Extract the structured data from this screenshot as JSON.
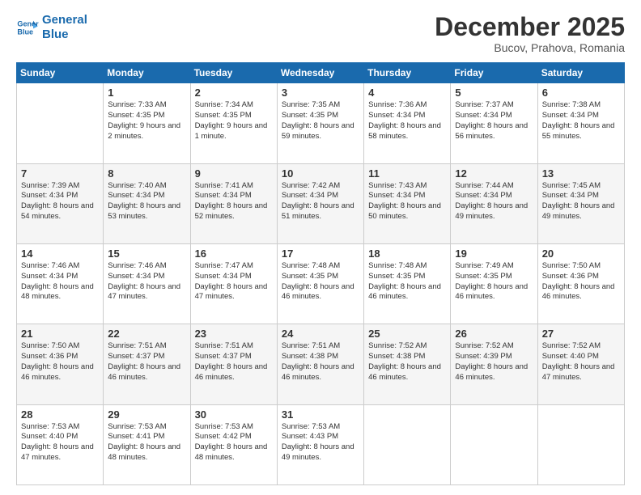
{
  "logo": {
    "line1": "General",
    "line2": "Blue"
  },
  "title": "December 2025",
  "location": "Bucov, Prahova, Romania",
  "days_header": [
    "Sunday",
    "Monday",
    "Tuesday",
    "Wednesday",
    "Thursday",
    "Friday",
    "Saturday"
  ],
  "weeks": [
    [
      {
        "day": "",
        "sunrise": "",
        "sunset": "",
        "daylight": ""
      },
      {
        "day": "1",
        "sunrise": "Sunrise: 7:33 AM",
        "sunset": "Sunset: 4:35 PM",
        "daylight": "Daylight: 9 hours and 2 minutes."
      },
      {
        "day": "2",
        "sunrise": "Sunrise: 7:34 AM",
        "sunset": "Sunset: 4:35 PM",
        "daylight": "Daylight: 9 hours and 1 minute."
      },
      {
        "day": "3",
        "sunrise": "Sunrise: 7:35 AM",
        "sunset": "Sunset: 4:35 PM",
        "daylight": "Daylight: 8 hours and 59 minutes."
      },
      {
        "day": "4",
        "sunrise": "Sunrise: 7:36 AM",
        "sunset": "Sunset: 4:34 PM",
        "daylight": "Daylight: 8 hours and 58 minutes."
      },
      {
        "day": "5",
        "sunrise": "Sunrise: 7:37 AM",
        "sunset": "Sunset: 4:34 PM",
        "daylight": "Daylight: 8 hours and 56 minutes."
      },
      {
        "day": "6",
        "sunrise": "Sunrise: 7:38 AM",
        "sunset": "Sunset: 4:34 PM",
        "daylight": "Daylight: 8 hours and 55 minutes."
      }
    ],
    [
      {
        "day": "7",
        "sunrise": "Sunrise: 7:39 AM",
        "sunset": "Sunset: 4:34 PM",
        "daylight": "Daylight: 8 hours and 54 minutes."
      },
      {
        "day": "8",
        "sunrise": "Sunrise: 7:40 AM",
        "sunset": "Sunset: 4:34 PM",
        "daylight": "Daylight: 8 hours and 53 minutes."
      },
      {
        "day": "9",
        "sunrise": "Sunrise: 7:41 AM",
        "sunset": "Sunset: 4:34 PM",
        "daylight": "Daylight: 8 hours and 52 minutes."
      },
      {
        "day": "10",
        "sunrise": "Sunrise: 7:42 AM",
        "sunset": "Sunset: 4:34 PM",
        "daylight": "Daylight: 8 hours and 51 minutes."
      },
      {
        "day": "11",
        "sunrise": "Sunrise: 7:43 AM",
        "sunset": "Sunset: 4:34 PM",
        "daylight": "Daylight: 8 hours and 50 minutes."
      },
      {
        "day": "12",
        "sunrise": "Sunrise: 7:44 AM",
        "sunset": "Sunset: 4:34 PM",
        "daylight": "Daylight: 8 hours and 49 minutes."
      },
      {
        "day": "13",
        "sunrise": "Sunrise: 7:45 AM",
        "sunset": "Sunset: 4:34 PM",
        "daylight": "Daylight: 8 hours and 49 minutes."
      }
    ],
    [
      {
        "day": "14",
        "sunrise": "Sunrise: 7:46 AM",
        "sunset": "Sunset: 4:34 PM",
        "daylight": "Daylight: 8 hours and 48 minutes."
      },
      {
        "day": "15",
        "sunrise": "Sunrise: 7:46 AM",
        "sunset": "Sunset: 4:34 PM",
        "daylight": "Daylight: 8 hours and 47 minutes."
      },
      {
        "day": "16",
        "sunrise": "Sunrise: 7:47 AM",
        "sunset": "Sunset: 4:34 PM",
        "daylight": "Daylight: 8 hours and 47 minutes."
      },
      {
        "day": "17",
        "sunrise": "Sunrise: 7:48 AM",
        "sunset": "Sunset: 4:35 PM",
        "daylight": "Daylight: 8 hours and 46 minutes."
      },
      {
        "day": "18",
        "sunrise": "Sunrise: 7:48 AM",
        "sunset": "Sunset: 4:35 PM",
        "daylight": "Daylight: 8 hours and 46 minutes."
      },
      {
        "day": "19",
        "sunrise": "Sunrise: 7:49 AM",
        "sunset": "Sunset: 4:35 PM",
        "daylight": "Daylight: 8 hours and 46 minutes."
      },
      {
        "day": "20",
        "sunrise": "Sunrise: 7:50 AM",
        "sunset": "Sunset: 4:36 PM",
        "daylight": "Daylight: 8 hours and 46 minutes."
      }
    ],
    [
      {
        "day": "21",
        "sunrise": "Sunrise: 7:50 AM",
        "sunset": "Sunset: 4:36 PM",
        "daylight": "Daylight: 8 hours and 46 minutes."
      },
      {
        "day": "22",
        "sunrise": "Sunrise: 7:51 AM",
        "sunset": "Sunset: 4:37 PM",
        "daylight": "Daylight: 8 hours and 46 minutes."
      },
      {
        "day": "23",
        "sunrise": "Sunrise: 7:51 AM",
        "sunset": "Sunset: 4:37 PM",
        "daylight": "Daylight: 8 hours and 46 minutes."
      },
      {
        "day": "24",
        "sunrise": "Sunrise: 7:51 AM",
        "sunset": "Sunset: 4:38 PM",
        "daylight": "Daylight: 8 hours and 46 minutes."
      },
      {
        "day": "25",
        "sunrise": "Sunrise: 7:52 AM",
        "sunset": "Sunset: 4:38 PM",
        "daylight": "Daylight: 8 hours and 46 minutes."
      },
      {
        "day": "26",
        "sunrise": "Sunrise: 7:52 AM",
        "sunset": "Sunset: 4:39 PM",
        "daylight": "Daylight: 8 hours and 46 minutes."
      },
      {
        "day": "27",
        "sunrise": "Sunrise: 7:52 AM",
        "sunset": "Sunset: 4:40 PM",
        "daylight": "Daylight: 8 hours and 47 minutes."
      }
    ],
    [
      {
        "day": "28",
        "sunrise": "Sunrise: 7:53 AM",
        "sunset": "Sunset: 4:40 PM",
        "daylight": "Daylight: 8 hours and 47 minutes."
      },
      {
        "day": "29",
        "sunrise": "Sunrise: 7:53 AM",
        "sunset": "Sunset: 4:41 PM",
        "daylight": "Daylight: 8 hours and 48 minutes."
      },
      {
        "day": "30",
        "sunrise": "Sunrise: 7:53 AM",
        "sunset": "Sunset: 4:42 PM",
        "daylight": "Daylight: 8 hours and 48 minutes."
      },
      {
        "day": "31",
        "sunrise": "Sunrise: 7:53 AM",
        "sunset": "Sunset: 4:43 PM",
        "daylight": "Daylight: 8 hours and 49 minutes."
      },
      {
        "day": "",
        "sunrise": "",
        "sunset": "",
        "daylight": ""
      },
      {
        "day": "",
        "sunrise": "",
        "sunset": "",
        "daylight": ""
      },
      {
        "day": "",
        "sunrise": "",
        "sunset": "",
        "daylight": ""
      }
    ]
  ]
}
